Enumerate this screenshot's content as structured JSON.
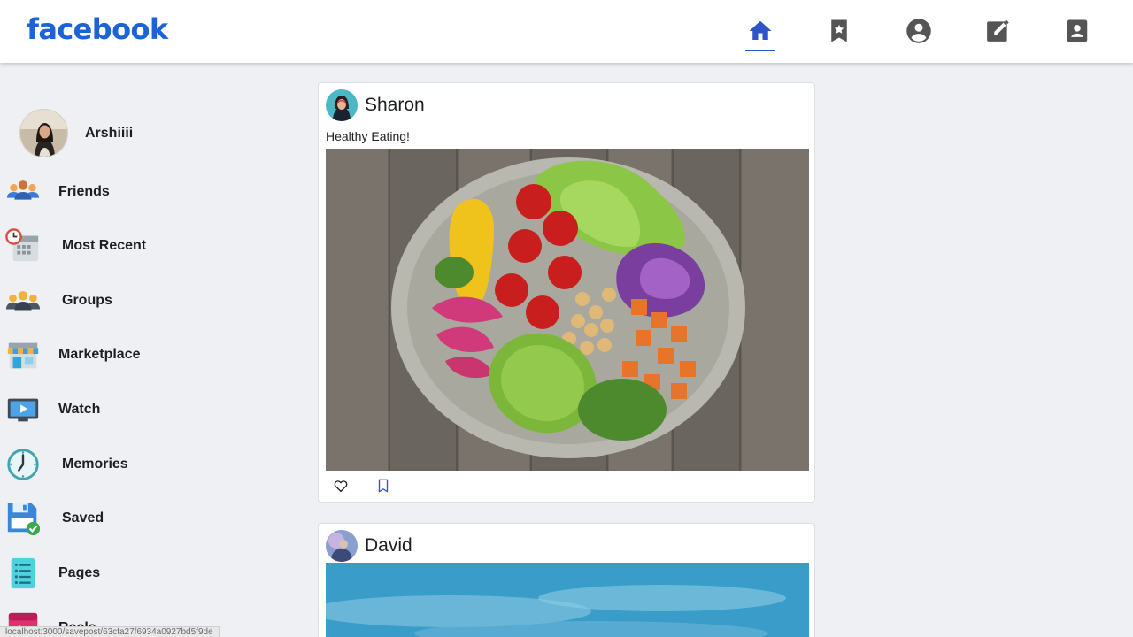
{
  "header": {
    "logo": "facebook",
    "nav": [
      {
        "name": "home-icon",
        "active": true
      },
      {
        "name": "bookmark-star-icon",
        "active": false
      },
      {
        "name": "account-circle-icon",
        "active": false
      },
      {
        "name": "edit-note-icon",
        "active": false
      },
      {
        "name": "contact-card-icon",
        "active": false
      }
    ]
  },
  "sidebar": {
    "profile_name": "Arshiiii",
    "items": [
      {
        "label": "Friends",
        "icon": "friends-icon"
      },
      {
        "label": "Most Recent",
        "icon": "most-recent-icon"
      },
      {
        "label": "Groups",
        "icon": "groups-icon"
      },
      {
        "label": "Marketplace",
        "icon": "marketplace-icon"
      },
      {
        "label": "Watch",
        "icon": "watch-icon"
      },
      {
        "label": "Memories",
        "icon": "memories-icon"
      },
      {
        "label": "Saved",
        "icon": "saved-icon"
      },
      {
        "label": "Pages",
        "icon": "pages-icon"
      },
      {
        "label": "Reels",
        "icon": "reels-icon"
      }
    ]
  },
  "posts": [
    {
      "author": "Sharon",
      "caption": "Healthy Eating!",
      "image": "salad-bowl-photo",
      "actions": [
        "heart-icon",
        "bookmark-icon"
      ]
    },
    {
      "author": "David",
      "caption": "",
      "image": "sky-photo"
    }
  ],
  "status_bar": {
    "url": "localhost:3000/savepost/63cfa27f6934a0927bd5f9de"
  },
  "colors": {
    "brand": "#1b64d8",
    "active_nav": "#2d55c8",
    "nav_icon": "#555555",
    "background": "#eef0f3"
  }
}
